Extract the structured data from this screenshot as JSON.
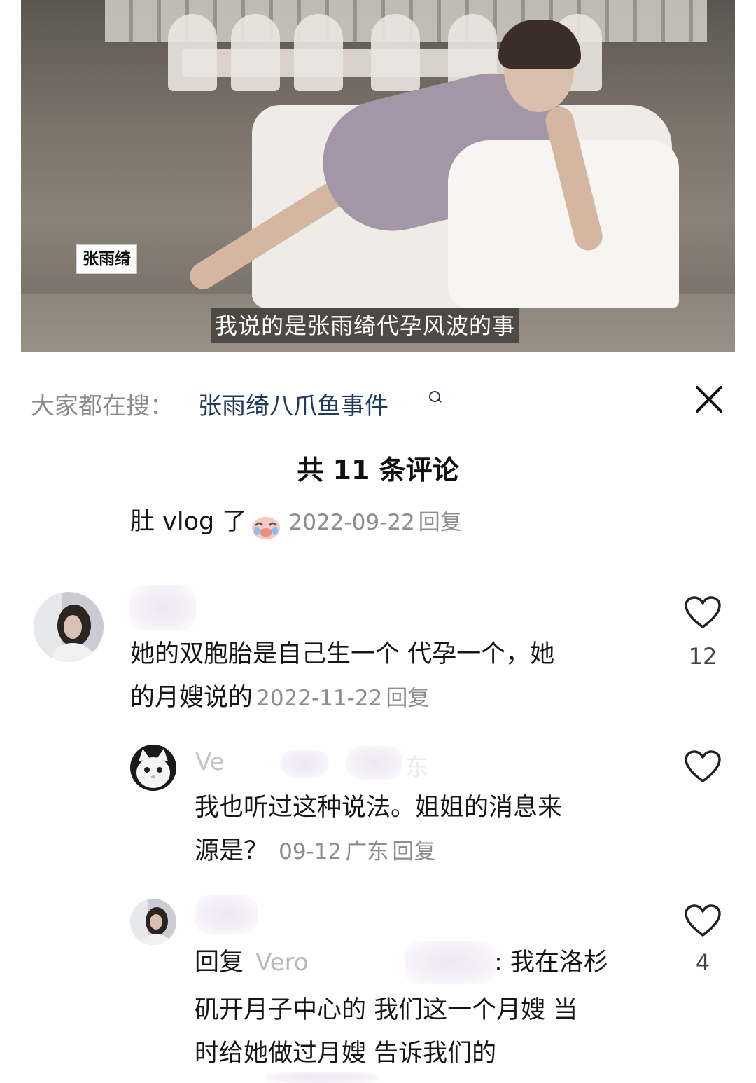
{
  "video": {
    "name_tag": "张雨绮",
    "subtitle": "我说的是张雨绮代孕风波的事"
  },
  "search": {
    "prefix": "大家都在搜：",
    "term": "张雨绮八爪鱼事件"
  },
  "comments_header": {
    "title": "共 11 条评论"
  },
  "previous_comment": {
    "text": "肚 vlog 了",
    "date": "2022-09-22",
    "reply_label": "回复"
  },
  "comment_main": {
    "text_line1": "她的双胞胎是自己生一个 代孕一个，她",
    "text_line2": "的月嫂说的",
    "date": "2022-11-22",
    "reply_label": "回复",
    "likes": "12"
  },
  "reply_1": {
    "author_fragment_a": "Ve",
    "author_fragment_b": "东",
    "text_line1": "我也听过这种说法。姐姐的消息来",
    "text_line2": "源是？",
    "date": "09-12",
    "location": "广东",
    "reply_label": "回复"
  },
  "reply_2": {
    "prefix": "回复",
    "mention": "Vero",
    "text_line1_tail": ": 我在洛杉",
    "text_line2": "矶开月子中心的 我们这一个月嫂 当",
    "text_line3": "时给她做过月嫂 告诉我们的",
    "likes": "4"
  },
  "colors": {
    "search_term": "#1f3a5c",
    "meta_gray": "#8d8d8d",
    "text": "#161616"
  }
}
